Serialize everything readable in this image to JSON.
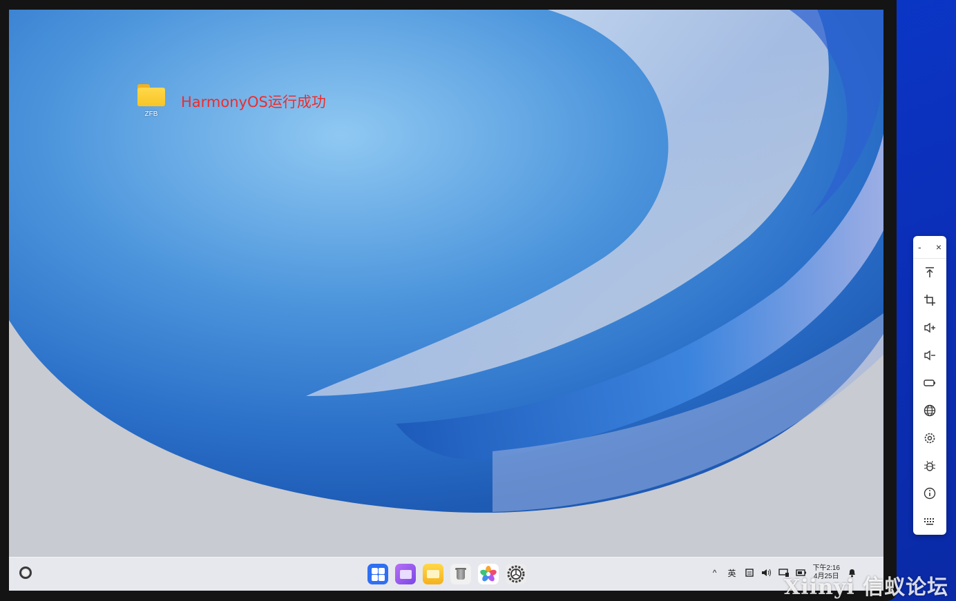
{
  "desktop": {
    "icons": [
      {
        "label": "ZFB",
        "icon": "folder-icon"
      }
    ],
    "overlay_text": "HarmonyOS运行成功",
    "overlay_color": "#ee2b2b"
  },
  "dock": {
    "apps": [
      {
        "name": "launcher",
        "icon": "app-grid-icon"
      },
      {
        "name": "multitask",
        "icon": "windows-icon"
      },
      {
        "name": "files",
        "icon": "files-icon"
      },
      {
        "name": "trash",
        "icon": "trash-icon"
      },
      {
        "name": "gallery",
        "icon": "gallery-icon"
      },
      {
        "name": "settings",
        "icon": "settings-icon"
      }
    ]
  },
  "tray": {
    "chevron": "^",
    "ime": "英",
    "clock_time": "下午2:16",
    "clock_date": "4月25日"
  },
  "tool_panel": {
    "minimize": "-",
    "close": "×",
    "buttons": [
      "to-top-icon",
      "crop-icon",
      "volume-up-icon",
      "volume-down-icon",
      "power-icon",
      "globe-icon",
      "gear-icon",
      "bug-icon",
      "info-icon",
      "keyboard-icon"
    ]
  },
  "watermark": "Xiinyi 信蚁论坛",
  "colors": {
    "background": "#0b2fb8",
    "bezel": "#141414",
    "taskbar": "#e8e9ee",
    "accent": "#2f6ff2"
  }
}
